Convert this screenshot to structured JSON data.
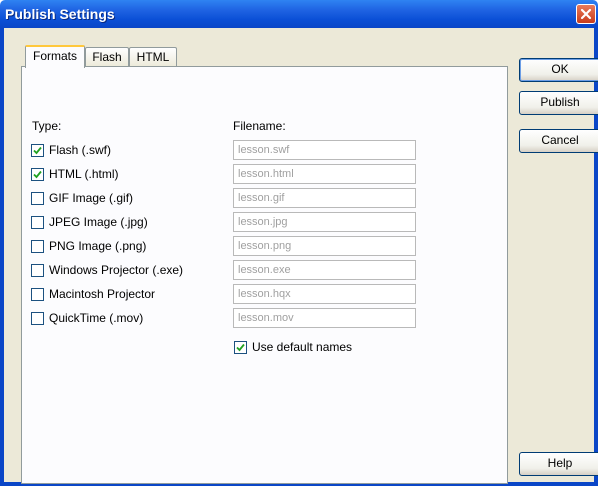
{
  "window": {
    "title": "Publish Settings"
  },
  "tabs": [
    {
      "label": "Formats",
      "active": true
    },
    {
      "label": "Flash",
      "active": false
    },
    {
      "label": "HTML",
      "active": false
    }
  ],
  "panel": {
    "type_header": "Type:",
    "filename_header": "Filename:",
    "formats": [
      {
        "label": "Flash  (.swf)",
        "checked": true,
        "filename": "lesson.swf"
      },
      {
        "label": "HTML (.html)",
        "checked": true,
        "filename": "lesson.html"
      },
      {
        "label": "GIF Image (.gif)",
        "checked": false,
        "filename": "lesson.gif"
      },
      {
        "label": "JPEG Image (.jpg)",
        "checked": false,
        "filename": "lesson.jpg"
      },
      {
        "label": "PNG Image (.png)",
        "checked": false,
        "filename": "lesson.png"
      },
      {
        "label": "Windows Projector (.exe)",
        "checked": false,
        "filename": "lesson.exe"
      },
      {
        "label": "Macintosh Projector",
        "checked": false,
        "filename": "lesson.hqx"
      },
      {
        "label": "QuickTime (.mov)",
        "checked": false,
        "filename": "lesson.mov"
      }
    ],
    "use_default_names": {
      "label": "Use default names",
      "checked": true
    }
  },
  "buttons": {
    "ok": "OK",
    "publish": "Publish",
    "cancel": "Cancel",
    "help": "Help"
  },
  "colors": {
    "titlebar": "#0a46c7",
    "dialog_bg": "#ece9d8",
    "check_mark": "#21a121",
    "tab_highlight": "#ffc83c"
  }
}
